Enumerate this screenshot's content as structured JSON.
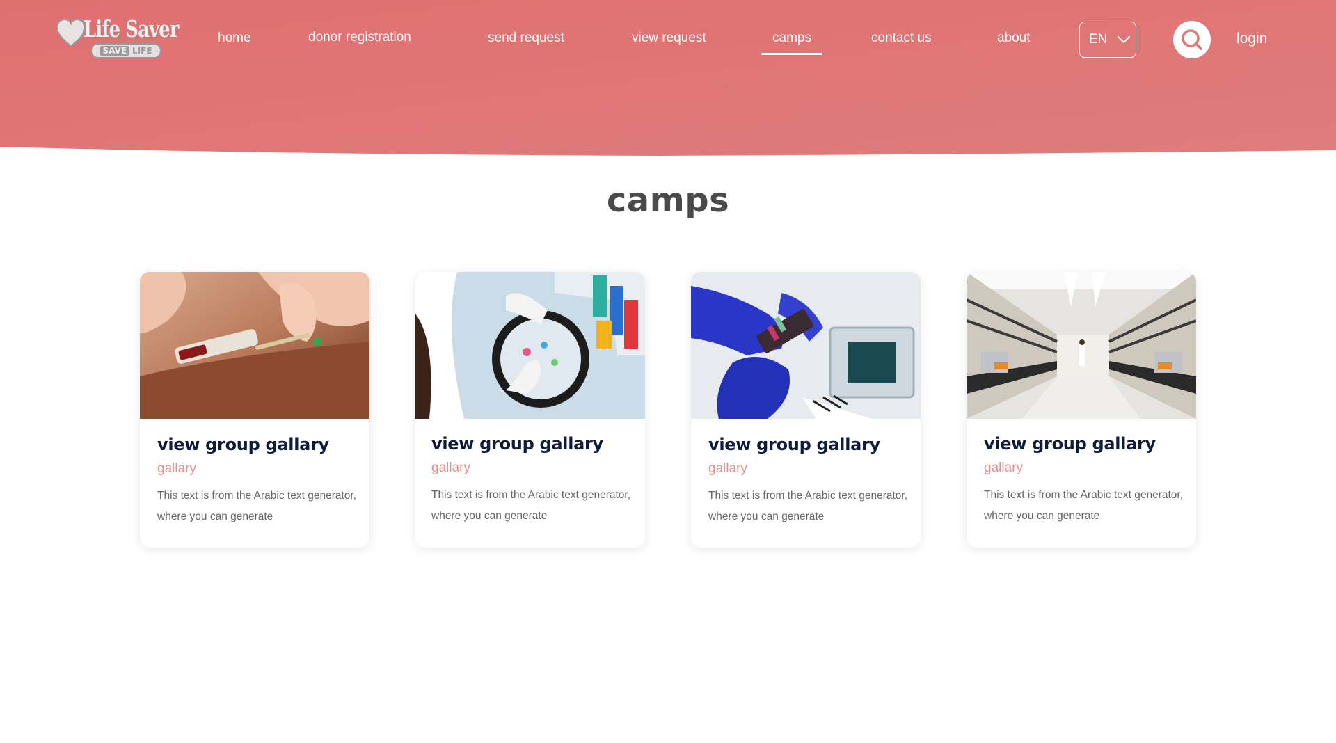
{
  "brand": {
    "name": "Life Saver",
    "badge_left": "SAVE",
    "badge_right": "LIFE",
    "header_color": "#e07878",
    "accent": "#e28f8f"
  },
  "nav": {
    "items": [
      {
        "label": "home",
        "active": false
      },
      {
        "label": "donor registration",
        "active": false
      },
      {
        "label": "send request",
        "active": false
      },
      {
        "label": "view request",
        "active": false
      },
      {
        "label": "camps",
        "active": true
      },
      {
        "label": "contact us",
        "active": false
      },
      {
        "label": "about",
        "active": false
      }
    ],
    "language": "EN",
    "language_icon": "chevron-down-icon",
    "search_icon": "search-icon",
    "login_label": "login"
  },
  "page": {
    "title": "camps"
  },
  "cards": [
    {
      "title": "view group gallary",
      "subtitle": "gallary",
      "description": "This text is from the Arabic text generator, where you can generate",
      "image": "blood-draw-photo"
    },
    {
      "title": "view group gallary",
      "subtitle": "gallary",
      "description": "This text is from the Arabic text generator, where you can generate",
      "image": "lab-ice-bucket-photo"
    },
    {
      "title": "view group gallary",
      "subtitle": "gallary",
      "description": "This text is from the Arabic text generator, where you can generate",
      "image": "gloved-hands-test-strip-photo"
    },
    {
      "title": "view group gallary",
      "subtitle": "gallary",
      "description": "This text is from the Arabic text generator, where you can generate",
      "image": "laboratory-room-photo"
    }
  ]
}
